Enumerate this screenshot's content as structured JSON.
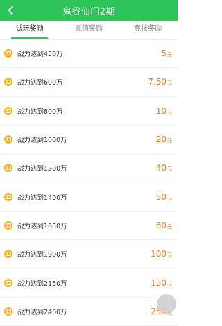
{
  "header": {
    "title": "鬼谷仙门2期"
  },
  "tabs": [
    {
      "label": "试玩奖励"
    },
    {
      "label": "充值奖励"
    },
    {
      "label": "竞技奖励"
    }
  ],
  "rewards": [
    {
      "label": "战力达到450万",
      "amount": "5",
      "unit": "元"
    },
    {
      "label": "战力达到600万",
      "amount": "7.50",
      "unit": "元"
    },
    {
      "label": "战力达到800万",
      "amount": "10",
      "unit": "元"
    },
    {
      "label": "战力达到1000万",
      "amount": "20",
      "unit": "元"
    },
    {
      "label": "战力达到1200万",
      "amount": "40",
      "unit": "元"
    },
    {
      "label": "战力达到1400万",
      "amount": "50",
      "unit": "元"
    },
    {
      "label": "战力达到1650万",
      "amount": "60",
      "unit": "元"
    },
    {
      "label": "战力达到1900万",
      "amount": "100",
      "unit": "元"
    },
    {
      "label": "战力达到2150万",
      "amount": "150",
      "unit": "元"
    },
    {
      "label": "战力达到2400万",
      "amount": "250",
      "unit": "元"
    }
  ],
  "colors": {
    "brand": "#2dc55a",
    "reward": "#f07a1f",
    "badge": "#f0b323"
  },
  "icons": {
    "back": "chevron-left-icon",
    "badge": "reward-badge-icon"
  }
}
